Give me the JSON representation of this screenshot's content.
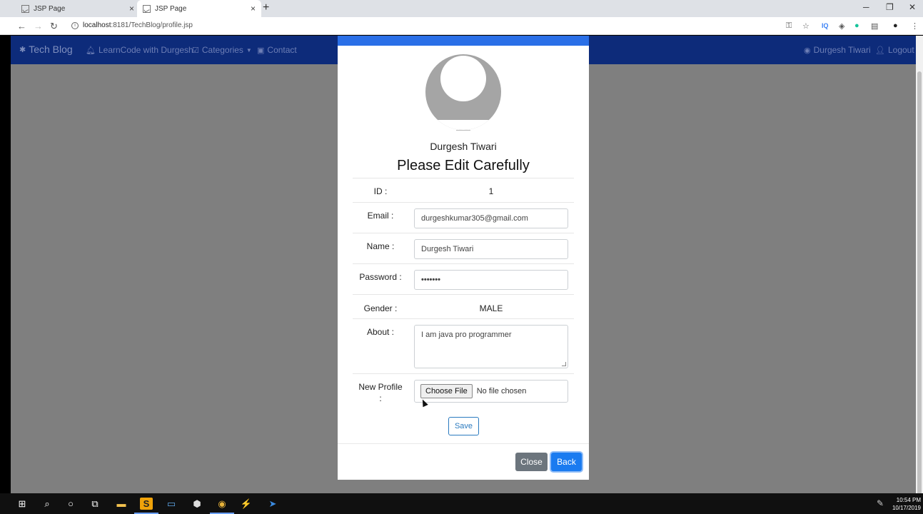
{
  "browser": {
    "tabs": [
      {
        "label": "JSP Page",
        "close": "×"
      },
      {
        "label": "JSP Page",
        "close": "×"
      }
    ],
    "new_tab": "+",
    "window_controls": {
      "minimize": "─",
      "restore": "❐",
      "close": "✕"
    },
    "nav": {
      "back": "←",
      "forward": "→",
      "reload": "↻"
    },
    "url": {
      "host": "localhost",
      "rest": ":8181/TechBlog/profile.jsp"
    },
    "extensions": [
      "key-icon",
      "star-icon",
      "iq-icon",
      "tag-icon",
      "grammarly-icon",
      "clipboard-icon",
      "profile-icon",
      "menu-icon"
    ]
  },
  "navbar": {
    "brand": "Tech Blog",
    "items": [
      {
        "label": "LearnCode with Durgesh",
        "icon": "bell-icon"
      },
      {
        "label": "Categories",
        "icon": "check-square-icon"
      },
      {
        "label": "Contact",
        "icon": "address-card-icon"
      }
    ],
    "user": "Durgesh Tiwari",
    "logout": "Logout"
  },
  "modal": {
    "user_name": "Durgesh Tiwari",
    "title": "Please Edit Carefully",
    "fields": {
      "id": {
        "label": "ID :",
        "value": "1"
      },
      "email": {
        "label": "Email :",
        "value": "durgeshkumar305@gmail.com"
      },
      "name": {
        "label": "Name :",
        "value": "Durgesh Tiwari"
      },
      "password": {
        "label": "Password :",
        "value": "•••••••"
      },
      "gender": {
        "label": "Gender :",
        "value": "MALE"
      },
      "about": {
        "label": "About :",
        "value": "I am java pro programmer"
      },
      "profile": {
        "label_line1": "New Profile",
        "label_line2": ":",
        "button": "Choose File",
        "status": "No file chosen"
      }
    },
    "save": "Save",
    "close": "Close",
    "back": "Back"
  },
  "taskbar": {
    "time": "10:54 PM",
    "date": "10/17/2019"
  }
}
